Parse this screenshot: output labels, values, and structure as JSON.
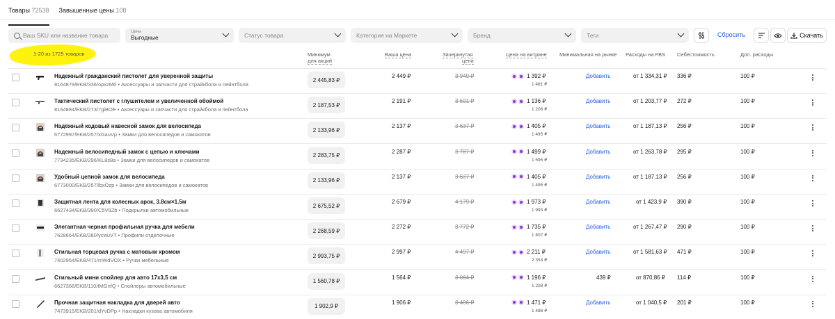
{
  "tabs": [
    {
      "label": "Товары",
      "count": "72538"
    },
    {
      "label": "Завышенные цены",
      "count": "108"
    }
  ],
  "filters": {
    "search_placeholder": "Ваш SKU или название товара",
    "prices_label": "Цены",
    "prices_value": "Выгодные",
    "status_placeholder": "Статус товара",
    "category_placeholder": "Категория на Маркете",
    "brand_placeholder": "Бренд",
    "tags_placeholder": "Теги",
    "reset_label": "Сбросить",
    "download_label": "Скачать"
  },
  "table": {
    "count_text": "1-20 из 1725 товаров",
    "headers": {
      "minimum": "Минимум",
      "minimum2": "для акций",
      "your_price": "Ваша цена",
      "strike": "Зачеркнутая",
      "strike2": "цена",
      "showcase": "Цена на витрине",
      "min_market": "Минимальная на рынке",
      "fbs": "Расходы на FBS",
      "cost": "Себестоимость",
      "extra": "Доп. расходы"
    },
    "add_label": "Добавить",
    "rows": [
      {
        "name": "Надежный гражданский пистолет для уверенной защиты",
        "sku": "8164879/EKB/336/opxzM6 • Аксессуары и запчасти для страйкбола и пейнтбола",
        "min": "2 445,83 ₽",
        "price": "2 449 ₽",
        "strike": "3 949 ₽",
        "vitrina": "1 392 ₽",
        "vitrina2": "1 481 ₽",
        "min_market": "",
        "fbs": "от 1 334,31 ₽",
        "cost": "336 ₽",
        "extra": "100 ₽",
        "thumb": "pistol"
      },
      {
        "name": "Тактический пистолет с глушителем и увеличенной обоймой",
        "sku": "8164884/EKB/273/7giBOE • Аксессуары и запчасти для страйкбола и пейнтбола",
        "min": "2 187,53 ₽",
        "price": "2 191 ₽",
        "strike": "3 691 ₽",
        "vitrina": "1 136 ₽",
        "vitrina2": "1 208 ₽",
        "min_market": "",
        "fbs": "от 1 203,77 ₽",
        "cost": "272 ₽",
        "extra": "100 ₽",
        "thumb": "pistol2"
      },
      {
        "name": "Надёжный кодовый навесной замок для велосипеда",
        "sku": "6772997/EKB/257/xGauVp • Замки для велосипедов и самокатов",
        "min": "2 133,96 ₽",
        "price": "2 137 ₽",
        "strike": "3 637 ₽",
        "vitrina": "1 405 ₽",
        "vitrina2": "1 495 ₽",
        "min_market": "",
        "fbs": "от 1 187,13 ₽",
        "cost": "256 ₽",
        "extra": "100 ₽",
        "thumb": "lock"
      },
      {
        "name": "Надежный велосипедный замок с цепью и ключами",
        "sku": "7734235/EKB/296/KL8s8a • Замки для велосипедов и самокатов",
        "min": "2 283,75 ₽",
        "price": "2 287 ₽",
        "strike": "3 787 ₽",
        "vitrina": "1 499 ₽",
        "vitrina2": "1 595 ₽",
        "min_market": "",
        "fbs": "от 1 263,78 ₽",
        "cost": "295 ₽",
        "extra": "100 ₽",
        "thumb": "lock"
      },
      {
        "name": "Удобный цепной замок для велосипеда",
        "sku": "6773000/EKB/257/lbxOzp • Замки для велосипедов и самокатов",
        "min": "2 133,96 ₽",
        "price": "2 137 ₽",
        "strike": "3 637 ₽",
        "vitrina": "1 405 ₽",
        "vitrina2": "1 495 ₽",
        "min_market": "",
        "fbs": "от 1 187,13 ₽",
        "cost": "256 ₽",
        "extra": "100 ₽",
        "thumb": "lock"
      },
      {
        "name": "Защитная лента для колесных арок, 3.8см×1.5м",
        "sku": "6627434/EKB/390/C5V9Zb • Подкрылки автомобильные",
        "min": "2 675,52 ₽",
        "price": "2 679 ₽",
        "strike": "4 179 ₽",
        "vitrina": "1 973 ₽",
        "vitrina2": "1 993 ₽",
        "min_market": "",
        "fbs": "от 1 423,9 ₽",
        "cost": "390 ₽",
        "extra": "100 ₽",
        "thumb": "tape"
      },
      {
        "name": "Элегантная черная профильная ручка для мебели",
        "sku": "7628664/EKB/280/ycwuVT • Профили отделочные",
        "min": "2 268,59 ₽",
        "price": "2 272 ₽",
        "strike": "3 772 ₽",
        "vitrina": "1 735 ₽",
        "vitrina2": "1 807 ₽",
        "min_market": "",
        "fbs": "от 1 267,47 ₽",
        "cost": "290 ₽",
        "extra": "100 ₽",
        "thumb": "handle"
      },
      {
        "name": "Стильная торцевая ручка с матовым хромом",
        "sku": "7402954/EKB/471/mWdVOX • Ручки мебельные",
        "min": "2 993,75 ₽",
        "price": "2 997 ₽",
        "strike": "4 497 ₽",
        "vitrina": "2 211 ₽",
        "vitrina2": "2 353 ₽",
        "min_market": "",
        "fbs": "от 1 581,63 ₽",
        "cost": "471 ₽",
        "extra": "100 ₽",
        "thumb": "handle2"
      },
      {
        "name": "Стильный мини спойлер для авто 17х3,5 см",
        "sku": "6627366/EKB/110/tMGnfQ • Спойлеры автомобильные",
        "min": "1 560,78 ₽",
        "price": "1 564 ₽",
        "strike": "3 064 ₽",
        "vitrina": "1 196 ₽",
        "vitrina2": "1 208 ₽",
        "min_market": "439 ₽",
        "fbs": "от 870,86 ₽",
        "cost": "114 ₽",
        "extra": "100 ₽",
        "thumb": "spoiler"
      },
      {
        "name": "Прочная защитная накладка для дверей авто",
        "sku": "7473915/EKB/201/dYvDPp • Накладки кузова автомобиля",
        "min": "1 902,9 ₽",
        "price": "1 906 ₽",
        "strike": "3 406 ₽",
        "vitrina": "1 471 ₽",
        "vitrina2": "1 486 ₽",
        "min_market": "",
        "fbs": "от 1 040,5 ₽",
        "cost": "201 ₽",
        "extra": "100 ₽",
        "thumb": "strip"
      }
    ]
  },
  "colors": {
    "accent": "#2962e6",
    "highlight": "#fff200",
    "badge": "#8a35d6"
  }
}
